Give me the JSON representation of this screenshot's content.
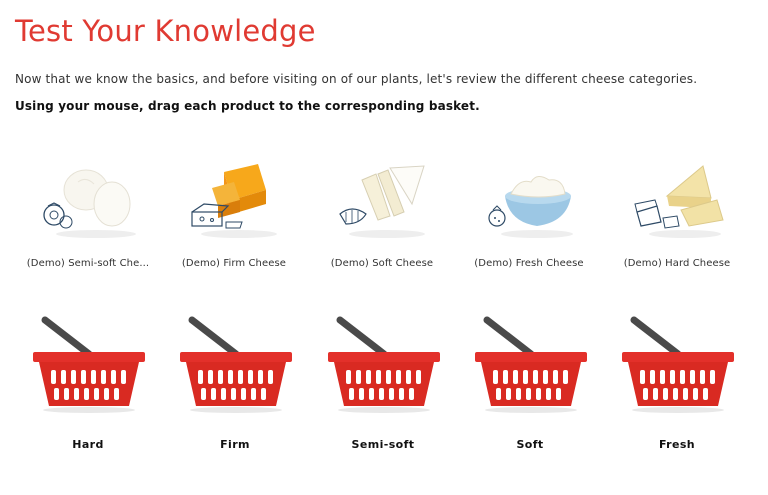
{
  "page": {
    "title": "Test Your Knowledge",
    "intro": "Now that we know the basics, and before visiting on of our plants, let's review the different cheese categories.",
    "instruction": "Using your mouse, drag each product to the corresponding basket."
  },
  "products": [
    {
      "label": "(Demo) Semi-soft Che...",
      "icon": "mozzarella-tomato-icon"
    },
    {
      "label": "(Demo) Firm Cheese",
      "icon": "cheddar-block-icon"
    },
    {
      "label": "(Demo) Soft Cheese",
      "icon": "brie-wedges-icon"
    },
    {
      "label": "(Demo) Fresh Cheese",
      "icon": "ricotta-bowl-icon"
    },
    {
      "label": "(Demo) Hard Cheese",
      "icon": "parmesan-wedge-icon"
    }
  ],
  "baskets": [
    {
      "label": "Hard",
      "icon": "shopping-basket-icon"
    },
    {
      "label": "Firm",
      "icon": "shopping-basket-icon"
    },
    {
      "label": "Semi-soft",
      "icon": "shopping-basket-icon"
    },
    {
      "label": "Soft",
      "icon": "shopping-basket-icon"
    },
    {
      "label": "Fresh",
      "icon": "shopping-basket-icon"
    }
  ],
  "colors": {
    "title": "#e03a32",
    "basket_red": "#d92a22",
    "basket_dark": "#a81a14",
    "handle": "#4a4a4a"
  }
}
